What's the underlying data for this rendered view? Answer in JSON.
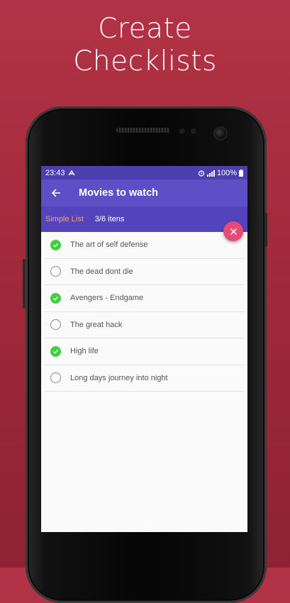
{
  "headline": {
    "line1": "Create",
    "line2": "Checklists"
  },
  "status_bar": {
    "time": "23:43",
    "battery": "100%"
  },
  "app_bar": {
    "title": "Movies to watch"
  },
  "sub_bar": {
    "list_type": "Simple List",
    "count": "3/6 itens"
  },
  "items": [
    {
      "label": "The art of self defense",
      "checked": true
    },
    {
      "label": "The dead dont die",
      "checked": false
    },
    {
      "label": "Avengers - Endgame",
      "checked": true
    },
    {
      "label": "The great hack",
      "checked": false
    },
    {
      "label": "High life",
      "checked": true
    },
    {
      "label": "Long days journey into night",
      "checked": false
    }
  ],
  "icons": {
    "back": "arrow-left-icon",
    "close": "close-icon",
    "checked": "check-circle-icon",
    "unchecked": "empty-circle-icon",
    "alarm": "alarm-icon",
    "signal": "signal-icon",
    "battery": "battery-icon"
  },
  "colors": {
    "background": "#a12a3b",
    "status_bar": "#4d3fb0",
    "app_bar": "#5e4fc7",
    "sub_bar": "#5344bb",
    "accent": "#e84a76",
    "list_type": "#f0a57a",
    "checked": "#3fcf3f"
  }
}
